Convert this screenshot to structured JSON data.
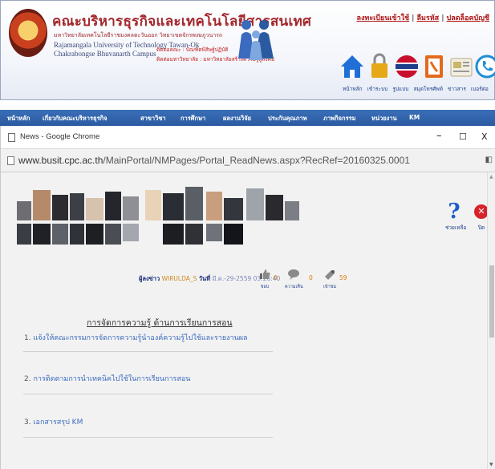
{
  "site": {
    "faculty_title": "คณะบริหารธุรกิจและเทคโนโลยีสารสนเทศ",
    "faculty_subtitle": "มหาวิทยาลัยเทคโนโลยีราชมงคลตะวันออก วิทยาเขตจักรพงษภูวนารถ",
    "university_en_1": "Rajamangala University of Technology Tawan-Ok",
    "university_en_2": "Chakrabongse Bhuvanarth Campus",
    "contact_1": "ติดต่อคณะ : บัณฑิตพิสิษฐ์ปฏิบัติ",
    "contact_2": "ติดต่อมหาวิทยาลัย : มหาวิทยาลัยสร้างความรู้สู่สังคม",
    "top_links": [
      "ลงทะเบียนเข้าใช้",
      "ลืมรหัส",
      "ปลดล็อคบัญชี"
    ],
    "quick_links": [
      "หน้าหลัก",
      "เข้าระบบ",
      "รูปแบบ",
      "สมุดโทรศัพท์",
      "ข่าวสาร",
      "เบอร์ต่อ"
    ]
  },
  "nav": [
    "หน้าหลัก",
    "เกี่ยวกับคณะบริหารธุรกิจ",
    "สาขาวิชา",
    "การศึกษา",
    "ผลงานวิจัย",
    "ประกันคุณภาพ",
    "ภาพกิจกรรม",
    "หน่วยงาน",
    "KM"
  ],
  "popup": {
    "window_title": "News - Google Chrome",
    "url_host": "www.busit.cpc.ac.th",
    "url_path": "/MainPortal/NMPages/Portal_ReadNews.aspx?RecRef=20160325.0001",
    "controls": {
      "minimize": "–",
      "maximize": "☐",
      "close": "X"
    }
  },
  "page": {
    "help_label": "ช่วยเหลือ",
    "close_label": "ปิด",
    "reporter_label": "ผู้ลงข่าว",
    "reporter_name": "WIRULDA_S",
    "date_label": "วันที่",
    "date_value": "มี.ค.-29-2559 03:26:40",
    "likes": {
      "count": "0",
      "caption": "ชอบ"
    },
    "comments": {
      "count": "0",
      "caption": "ความเห็น"
    },
    "views": {
      "count": "59",
      "caption": "เข้าชม"
    },
    "article_heading": "การจัดการความรู้ ด้านการเรียนการสอน",
    "items": [
      {
        "num": "1.",
        "text": "แจ้งให้คณะกรรมการจัดการความรู้นำองค์ความรู้ไปใช้และรายงานผล"
      },
      {
        "num": "2.",
        "text": "การติดตามการนำเทคนิคไปใช้ในการเรียนการสอน"
      },
      {
        "num": "3.",
        "text": "เอกสารสรุป KM"
      }
    ]
  },
  "colors": {
    "brand_red": "#a2262a",
    "nav_blue": "#2b5aa1",
    "link_blue": "#3b6bbf",
    "reporter_orange": "#d08a1a"
  },
  "icons": [
    "seal-icon",
    "home-icon",
    "lock-icon",
    "globe-flag-icon",
    "phonebook-icon",
    "news-icon",
    "phone-icon",
    "help-icon",
    "close-icon",
    "thumbs-up-icon",
    "comment-icon",
    "view-icon"
  ]
}
